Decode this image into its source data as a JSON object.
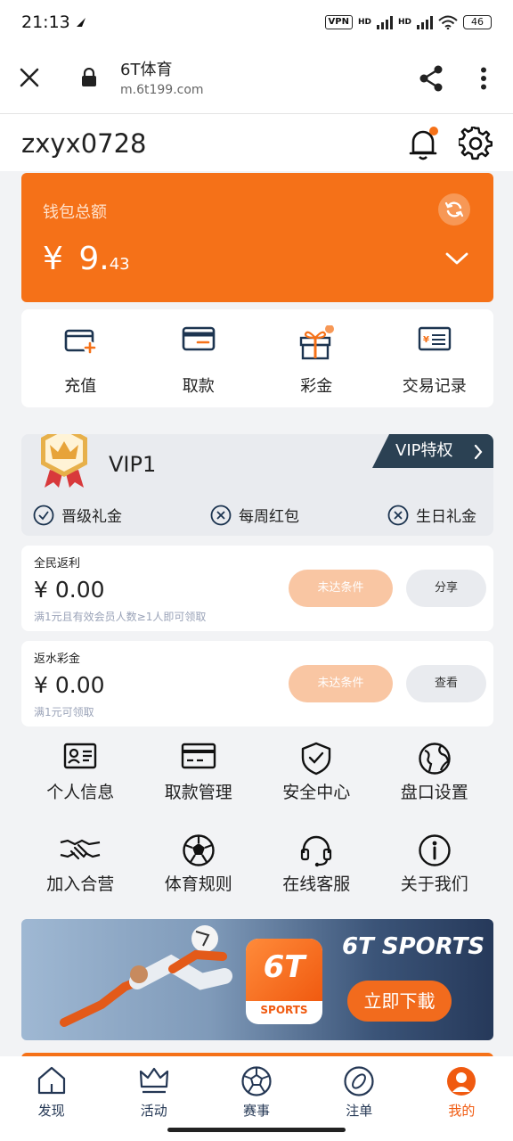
{
  "status": {
    "time": "21:13",
    "vpn": "VPN",
    "hd1": "HD",
    "hd2": "HD",
    "battery": "46"
  },
  "browser": {
    "title": "6T体育",
    "url": "m.6t199.com"
  },
  "user": {
    "name": "zxyx0728"
  },
  "wallet": {
    "label": "钱包总额",
    "currency": "¥",
    "integer": "9.",
    "decimal": "43"
  },
  "quick_actions": [
    {
      "label": "充值",
      "icon": "wallet-plus-icon"
    },
    {
      "label": "取款",
      "icon": "card-icon"
    },
    {
      "label": "彩金",
      "icon": "gift-icon"
    },
    {
      "label": "交易记录",
      "icon": "receipt-icon"
    }
  ],
  "vip": {
    "level": "VIP1",
    "privilege_label": "VIP特权",
    "perks": [
      {
        "label": "晋级礼金",
        "status": "check"
      },
      {
        "label": "每周红包",
        "status": "cross"
      },
      {
        "label": "生日礼金",
        "status": "cross"
      }
    ]
  },
  "cards": [
    {
      "title": "全民返利",
      "value": "¥ 0.00",
      "note": "满1元且有效会员人数≥1人即可领取",
      "status_button": "未达条件",
      "action_button": "分享"
    },
    {
      "title": "返水彩金",
      "value": "¥ 0.00",
      "note": "满1元可领取",
      "status_button": "未达条件",
      "action_button": "查看"
    }
  ],
  "menu": [
    {
      "label": "个人信息",
      "icon": "id-card-icon"
    },
    {
      "label": "取款管理",
      "icon": "card-icon"
    },
    {
      "label": "安全中心",
      "icon": "shield-icon"
    },
    {
      "label": "盘口设置",
      "icon": "globe-icon"
    },
    {
      "label": "加入合营",
      "icon": "handshake-icon"
    },
    {
      "label": "体育规则",
      "icon": "soccer-ball-icon"
    },
    {
      "label": "在线客服",
      "icon": "headset-icon"
    },
    {
      "label": "关于我们",
      "icon": "info-icon"
    }
  ],
  "banner": {
    "brand": "6T SPORTS",
    "download": "立即下載",
    "app_mark": "6T",
    "app_text": "SPORTS"
  },
  "tabs": [
    {
      "label": "发现",
      "icon": "home-icon"
    },
    {
      "label": "活动",
      "icon": "crown-icon"
    },
    {
      "label": "赛事",
      "icon": "soccer-ball-icon"
    },
    {
      "label": "注单",
      "icon": "ticket-icon"
    },
    {
      "label": "我的",
      "icon": "user-icon",
      "active": true
    }
  ],
  "colors": {
    "accent": "#f57118",
    "navy": "#2b4153",
    "tab_text": "#243754"
  }
}
